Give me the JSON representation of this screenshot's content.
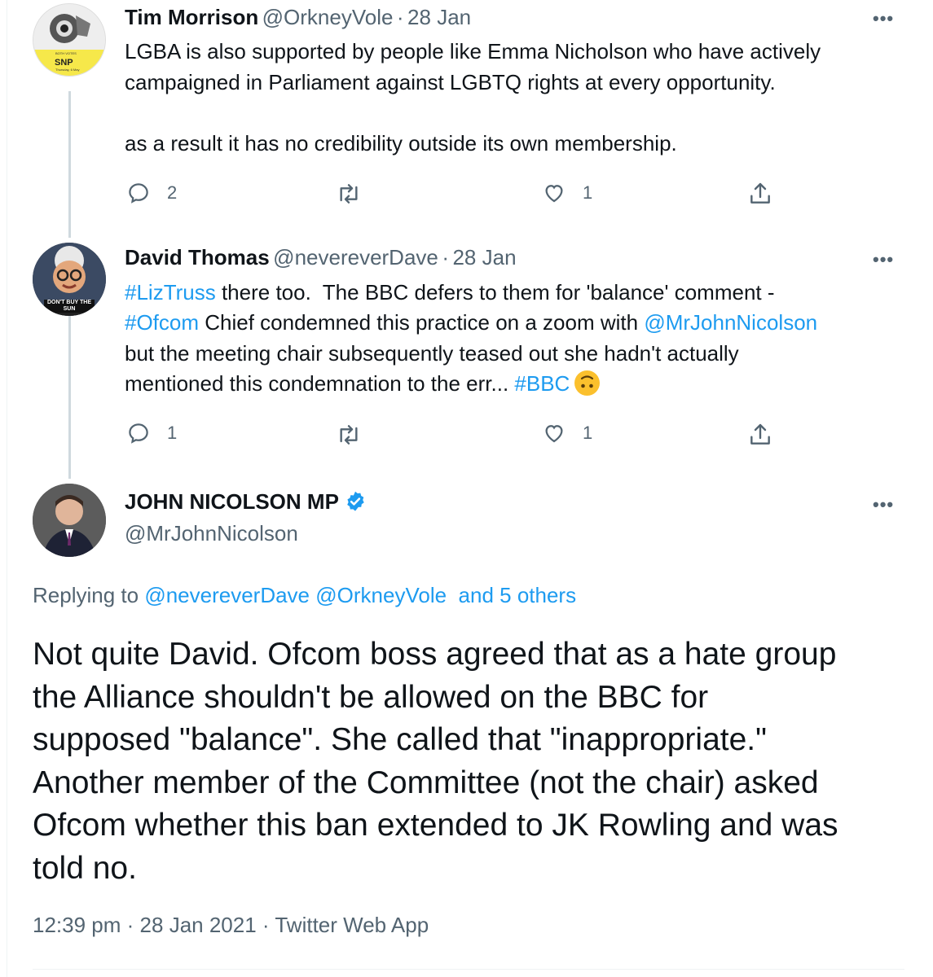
{
  "tweets": [
    {
      "author_name": "Tim Morrison",
      "handle": "@OrkneyVole",
      "separator": "·",
      "date": "28 Jan",
      "avatar_badge": "SNP",
      "avatar_badge_small": "BOTH VOTES",
      "avatar_caption": "Thursday, 6 May",
      "lines": [
        "LGBA is also supported by people like Emma Nicholson who have actively",
        "campaigned in Parliament against LGBTQ rights at every opportunity.",
        "as a result it has no credibility outside its own membership."
      ],
      "reply_count": "2",
      "retweet_count": "",
      "like_count": "1",
      "more_label": "•••"
    },
    {
      "author_name": "David Thomas",
      "handle": "@nevereverDave",
      "separator": "·",
      "date": "28 Jan",
      "avatar_caption": "DON'T BUY THE SUN",
      "line1_tag": "#LizTruss",
      "line1_text": " there too.  The BBC defers to them for 'balance' comment -",
      "line2_tag": "#Ofcom",
      "line2_text": " Chief condemned this practice on a zoom with ",
      "line2_mention": "@MrJohnNicolson",
      "line3_text": "but the meeting chair subsequently teased out she hadn't actually",
      "line4_text": "mentioned this condemnation to the err... ",
      "line4_tag": "#BBC",
      "reply_count": "1",
      "retweet_count": "",
      "like_count": "1",
      "more_label": "•••"
    }
  ],
  "main_tweet": {
    "author_name": "JOHN NICOLSON MP",
    "handle": "@MrJohnNicolson",
    "verified_icon": "verified-badge-icon",
    "more_label": "•••",
    "replying_prefix": "Replying to ",
    "replying_mention1": "@nevereverDave",
    "replying_mention2": "@OrkneyVole",
    "replying_others": "and 5 others",
    "text_lines": [
      "Not quite David. Ofcom boss agreed that as a hate group",
      "the Alliance shouldn't be allowed on the BBC for",
      "supposed \"balance\". She called that \"inappropriate.\"",
      "Another member of the Committee (not the chair) asked",
      "Ofcom whether this ban extended to JK Rowling and was",
      "told no."
    ],
    "time": "12:39 pm",
    "date": "28 Jan 2021",
    "source": "Twitter Web App",
    "separator": "·"
  },
  "colors": {
    "link": "#1d9bf0",
    "secondary": "#536471",
    "thread_line": "#cfd9de",
    "verified": "#1d9bf0"
  }
}
